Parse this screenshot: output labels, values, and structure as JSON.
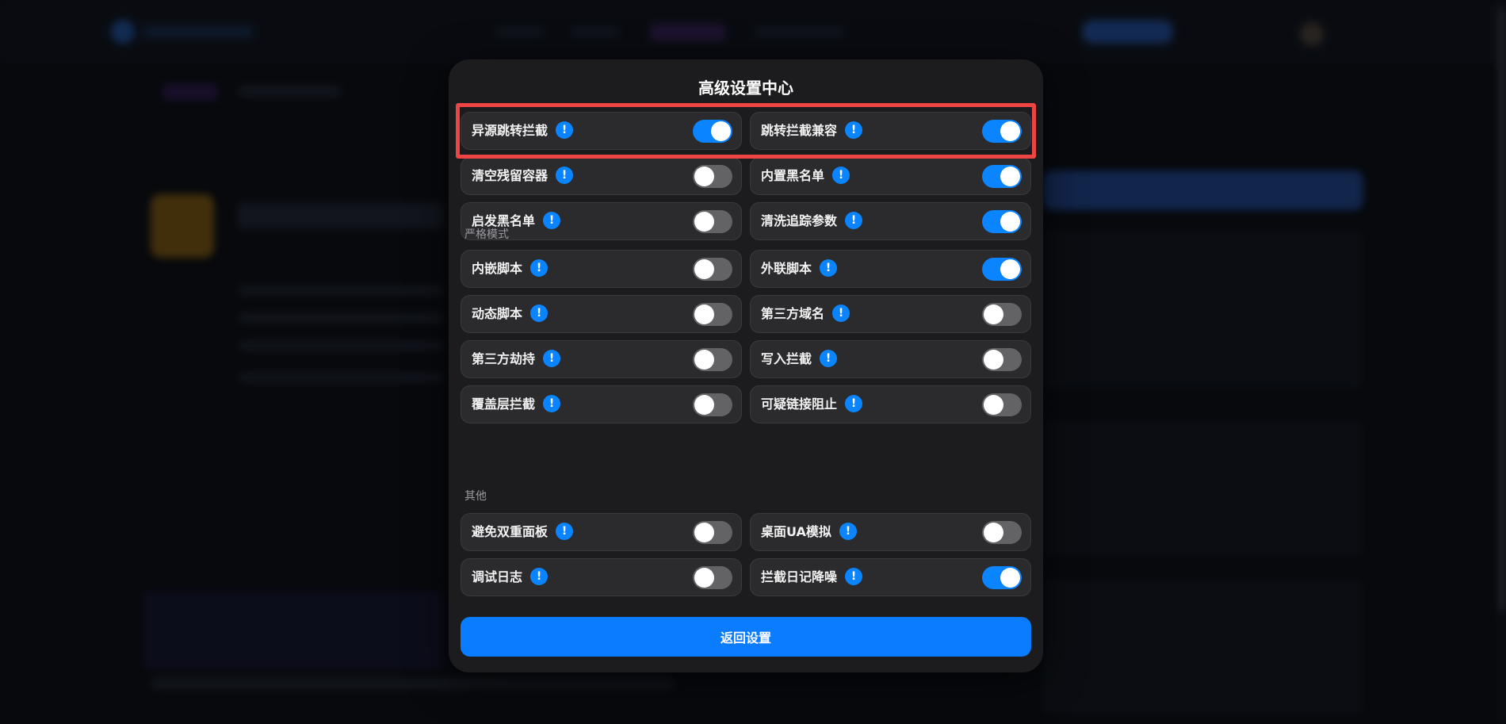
{
  "modal": {
    "title": "高级设置中心",
    "rows_top": [
      {
        "left": {
          "label": "异源跳转拦截",
          "on": true
        },
        "right": {
          "label": "跳转拦截兼容",
          "on": true
        }
      },
      {
        "left": {
          "label": "清空残留容器",
          "on": false
        },
        "right": {
          "label": "内置黑名单",
          "on": true
        }
      },
      {
        "left": {
          "label": "启发黑名单",
          "on": false
        },
        "right": {
          "label": "清洗追踪参数",
          "on": true
        }
      }
    ],
    "strict_section_label": "严格模式",
    "rows_strict": [
      {
        "left": {
          "label": "内嵌脚本",
          "on": false
        },
        "right": {
          "label": "外联脚本",
          "on": true
        }
      },
      {
        "left": {
          "label": "动态脚本",
          "on": false
        },
        "right": {
          "label": "第三方域名",
          "on": false
        }
      },
      {
        "left": {
          "label": "第三方劫持",
          "on": false
        },
        "right": {
          "label": "写入拦截",
          "on": false
        }
      },
      {
        "left": {
          "label": "覆盖层拦截",
          "on": false
        },
        "right": {
          "label": "可疑链接阻止",
          "on": false
        }
      }
    ],
    "other_section_label": "其他",
    "rows_other": [
      {
        "left": {
          "label": "避免双重面板",
          "on": false
        },
        "right": {
          "label": "桌面UA模拟",
          "on": false
        }
      },
      {
        "left": {
          "label": "调试日志",
          "on": false
        },
        "right": {
          "label": "拦截日记降噪",
          "on": true
        }
      }
    ],
    "return_button_label": "返回设置",
    "info_glyph": "!"
  },
  "colors": {
    "accent": "#0a84ff",
    "toggle_off": "#636366",
    "highlight": "#ef4444",
    "modal_bg": "#1c1c1e"
  }
}
